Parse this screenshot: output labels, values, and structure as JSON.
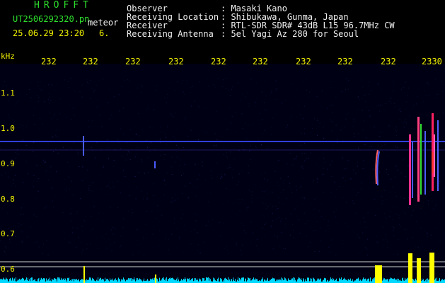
{
  "app": {
    "brand": "HROFFT",
    "file_name": "UT2506292320.pn",
    "meteor_label": "meteor",
    "datetime": "25.06.29 23:20",
    "counter": "6."
  },
  "info": [
    {
      "label": "Observer",
      "value": ": Masaki Kano"
    },
    {
      "label": "Receiving Location",
      "value": ": Shibukawa, Gunma, Japan"
    },
    {
      "label": "Receiver",
      "value": ": RTL-SDR SDR# 43dB L15 96.7MHz CW"
    },
    {
      "label": "Receiving Antenna",
      "value": ": 5el Yagi Az 280 for Seoul"
    }
  ],
  "axis": {
    "y_unit": "kHz",
    "y_ticks": [
      "1.1",
      "1.0",
      "0.9",
      "0.8",
      "0.7",
      "0.6"
    ],
    "x_ticks": [
      "232",
      "232",
      "232",
      "232",
      "232",
      "232",
      "232",
      "232",
      "232",
      "2330"
    ]
  },
  "colors": {
    "text_green": "#2ee02e",
    "text_yellow": "#f2f200",
    "text_white": "#f0f0f0",
    "background": "#000000",
    "signal_noise": "#1c1c6e",
    "carrier_line": "#3a4cff",
    "activity_bar": "#00d8ff",
    "activity_peak": "#ffff00"
  }
}
